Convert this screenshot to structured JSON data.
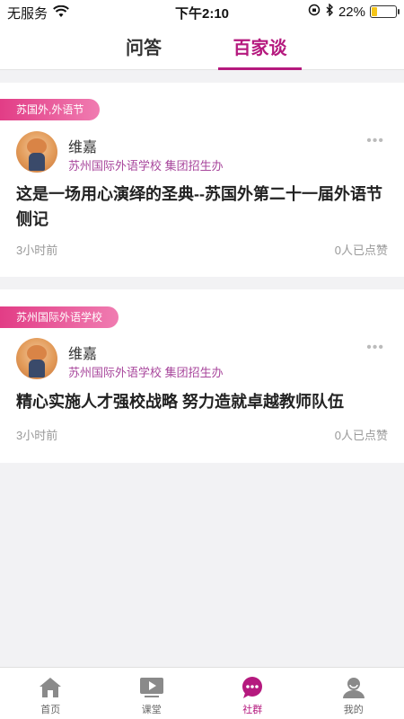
{
  "status_bar": {
    "carrier": "无服务",
    "time": "下午2:10",
    "battery": "22%",
    "battery_level": 0.22
  },
  "tabs": [
    {
      "label": "问答",
      "active": false
    },
    {
      "label": "百家谈",
      "active": true
    }
  ],
  "posts": [
    {
      "tag": "苏国外,外语节",
      "author": "维嘉",
      "org": "苏州国际外语学校 集团招生办",
      "title": "这是一场用心演绎的圣典--苏国外第二十一届外语节侧记",
      "time": "3小时前",
      "likes": "0人已点赞"
    },
    {
      "tag": "苏州国际外语学校",
      "author": "维嘉",
      "org": "苏州国际外语学校 集团招生办",
      "title": "精心实施人才强校战略 努力造就卓越教师队伍",
      "time": "3小时前",
      "likes": "0人已点赞"
    }
  ],
  "bottom_nav": [
    {
      "label": "首页",
      "icon": "home-icon",
      "active": false
    },
    {
      "label": "课堂",
      "icon": "video-icon",
      "active": false
    },
    {
      "label": "社群",
      "icon": "chat-icon",
      "active": true
    },
    {
      "label": "我的",
      "icon": "user-icon",
      "active": false
    }
  ],
  "colors": {
    "accent": "#b5197e",
    "tag_start": "#e23d86",
    "tag_end": "#f07cb1",
    "org_text": "#a8479c"
  }
}
